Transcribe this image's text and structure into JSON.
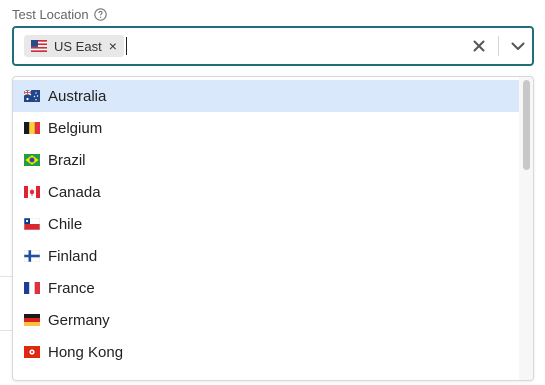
{
  "field": {
    "label": "Test Location"
  },
  "selected": [
    {
      "label": "US East",
      "flag": "us-flag"
    }
  ],
  "menu": {
    "highlighted_index": 0,
    "options": [
      {
        "label": "Australia",
        "flag": "au-flag"
      },
      {
        "label": "Belgium",
        "flag": "be-flag"
      },
      {
        "label": "Brazil",
        "flag": "br-flag"
      },
      {
        "label": "Canada",
        "flag": "ca-flag"
      },
      {
        "label": "Chile",
        "flag": "cl-flag"
      },
      {
        "label": "Finland",
        "flag": "fi-flag"
      },
      {
        "label": "France",
        "flag": "fr-flag"
      },
      {
        "label": "Germany",
        "flag": "de-flag"
      },
      {
        "label": "Hong Kong",
        "flag": "hk-flag"
      }
    ]
  },
  "icons": {
    "help": "question-circle-icon",
    "chip_remove": "close-icon",
    "clear": "clear-icon",
    "dropdown": "chevron-down-icon"
  },
  "colors": {
    "focus_border": "#1f6f78",
    "highlight": "#d9e8fb"
  }
}
